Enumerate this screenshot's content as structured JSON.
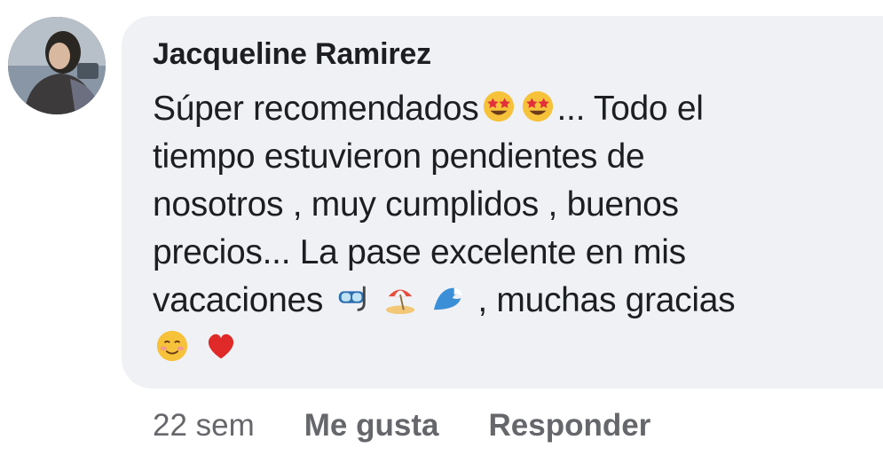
{
  "comment": {
    "author": "Jacqueline Ramirez",
    "avatar_icon": "profile-photo",
    "lines": [
      [
        "Súper recomendados",
        {
          "emoji": "star-struck-icon"
        },
        {
          "emoji": "star-struck-icon"
        },
        "... Todo el"
      ],
      [
        "tiempo estuvieron pendientes de"
      ],
      [
        "nosotros , muy cumplidos , buenos"
      ],
      [
        "precios... La pase excelente en mis"
      ],
      [
        "vacaciones ",
        {
          "emoji": "diving-mask-icon"
        },
        " ",
        {
          "emoji": "beach-umbrella-icon"
        },
        " ",
        {
          "emoji": "wave-icon"
        },
        " , muchas gracias"
      ],
      [
        {
          "emoji": "smiling-face-icon"
        },
        " ",
        {
          "emoji": "red-heart-icon"
        }
      ]
    ],
    "text": {
      "l1": "Súper recomendados",
      "l1b": "... Todo el",
      "l2": "tiempo estuvieron pendientes de",
      "l3": "nosotros , muy cumplidos , buenos",
      "l4": "precios... La pase excelente en mis",
      "l5a": "vacaciones",
      "l5b": ", muchas gracias"
    }
  },
  "actions": {
    "timestamp": "22 sem",
    "like_label": "Me gusta",
    "reply_label": "Responder"
  },
  "colors": {
    "bubble": "#eff1f4",
    "text": "#1c1e21",
    "meta": "#65676b"
  }
}
